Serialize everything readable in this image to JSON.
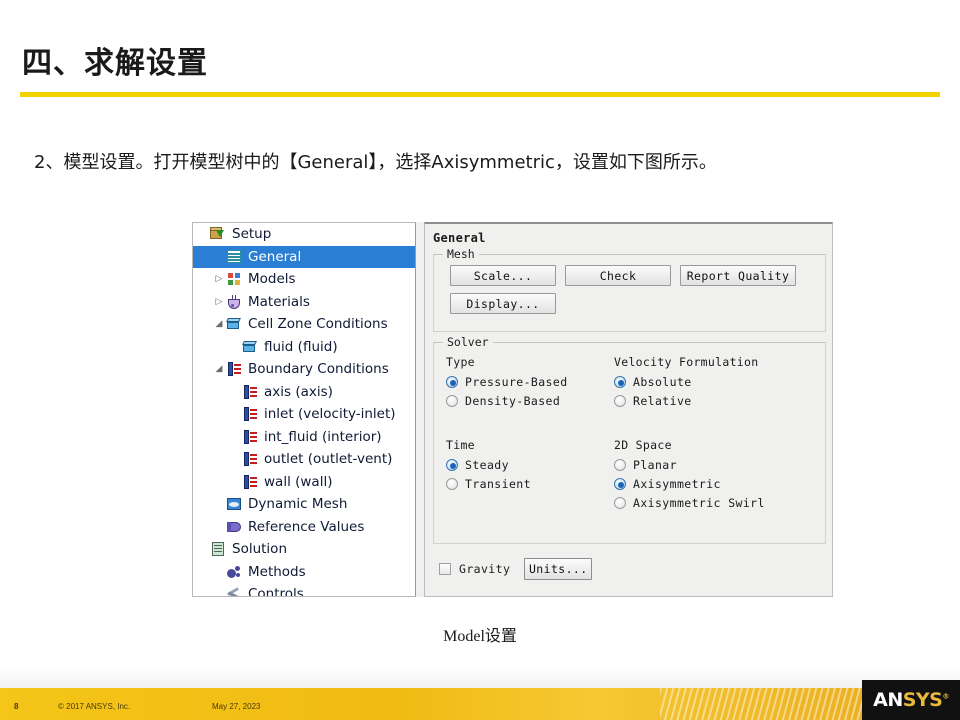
{
  "slide": {
    "title": "四、求解设置",
    "body_text": "2、模型设置。打开模型树中的【General】，选择Axisymmetric，设置如下图所示。",
    "figure_caption": "Model设置",
    "accent_color": "#f2d200"
  },
  "tree": {
    "items": [
      {
        "label": "Setup",
        "icon": "setup-icon",
        "indent": 0,
        "twisty": "",
        "selected": false
      },
      {
        "label": "General",
        "icon": "general-icon",
        "indent": 1,
        "twisty": "",
        "selected": true
      },
      {
        "label": "Models",
        "icon": "models-icon",
        "indent": 1,
        "twisty": "collapsed",
        "selected": false
      },
      {
        "label": "Materials",
        "icon": "materials-flask-icon",
        "indent": 1,
        "twisty": "collapsed",
        "selected": false
      },
      {
        "label": "Cell Zone Conditions",
        "icon": "cell-zone-icon",
        "indent": 1,
        "twisty": "expanded",
        "selected": false
      },
      {
        "label": "fluid (fluid)",
        "icon": "cell-zone-icon",
        "indent": 2,
        "twisty": "",
        "selected": false
      },
      {
        "label": "Boundary Conditions",
        "icon": "boundary-condition-icon",
        "indent": 1,
        "twisty": "expanded",
        "selected": false
      },
      {
        "label": "axis (axis)",
        "icon": "boundary-condition-icon",
        "indent": 2,
        "twisty": "",
        "selected": false
      },
      {
        "label": "inlet (velocity-inlet)",
        "icon": "boundary-condition-icon",
        "indent": 2,
        "twisty": "",
        "selected": false
      },
      {
        "label": "int_fluid (interior)",
        "icon": "boundary-condition-icon",
        "indent": 2,
        "twisty": "",
        "selected": false
      },
      {
        "label": "outlet (outlet-vent)",
        "icon": "boundary-condition-icon",
        "indent": 2,
        "twisty": "",
        "selected": false
      },
      {
        "label": "wall (wall)",
        "icon": "boundary-condition-icon",
        "indent": 2,
        "twisty": "",
        "selected": false
      },
      {
        "label": "Dynamic Mesh",
        "icon": "dynamic-mesh-icon",
        "indent": 1,
        "twisty": "",
        "selected": false
      },
      {
        "label": "Reference Values",
        "icon": "reference-values-book-icon",
        "indent": 1,
        "twisty": "",
        "selected": false
      },
      {
        "label": "Solution",
        "icon": "solution-icon",
        "indent": 0,
        "twisty": "",
        "selected": false
      },
      {
        "label": "Methods",
        "icon": "methods-icon",
        "indent": 1,
        "twisty": "",
        "selected": false
      },
      {
        "label": "Controls",
        "icon": "controls-icon",
        "indent": 1,
        "twisty": "",
        "selected": false
      }
    ],
    "selection_color": "#2a7fd4"
  },
  "panel": {
    "title": "General",
    "mesh": {
      "group_label": "Mesh",
      "buttons": [
        "Scale...",
        "Check",
        "Report Quality",
        "Display..."
      ]
    },
    "solver": {
      "group_label": "Solver",
      "type": {
        "heading": "Type",
        "options": [
          "Pressure-Based",
          "Density-Based"
        ],
        "selected": "Pressure-Based"
      },
      "velocity_formulation": {
        "heading": "Velocity Formulation",
        "options": [
          "Absolute",
          "Relative"
        ],
        "selected": "Absolute"
      },
      "time": {
        "heading": "Time",
        "options": [
          "Steady",
          "Transient"
        ],
        "selected": "Steady"
      },
      "space_2d": {
        "heading": "2D Space",
        "options": [
          "Planar",
          "Axisymmetric",
          "Axisymmetric Swirl"
        ],
        "selected": "Axisymmetric"
      }
    },
    "gravity": {
      "label": "Gravity",
      "checked": false
    },
    "units_button": "Units..."
  },
  "annotation": {
    "arrow_color": "#e01b1b",
    "points_at": "Axisymmetric"
  },
  "footer": {
    "page_number": "8",
    "copyright": "© 2017  ANSYS, Inc.",
    "date": "May 27, 2023",
    "logo_first": "AN",
    "logo_second": "SYS",
    "logo_tm": "®",
    "band_color": "#f5c518"
  }
}
